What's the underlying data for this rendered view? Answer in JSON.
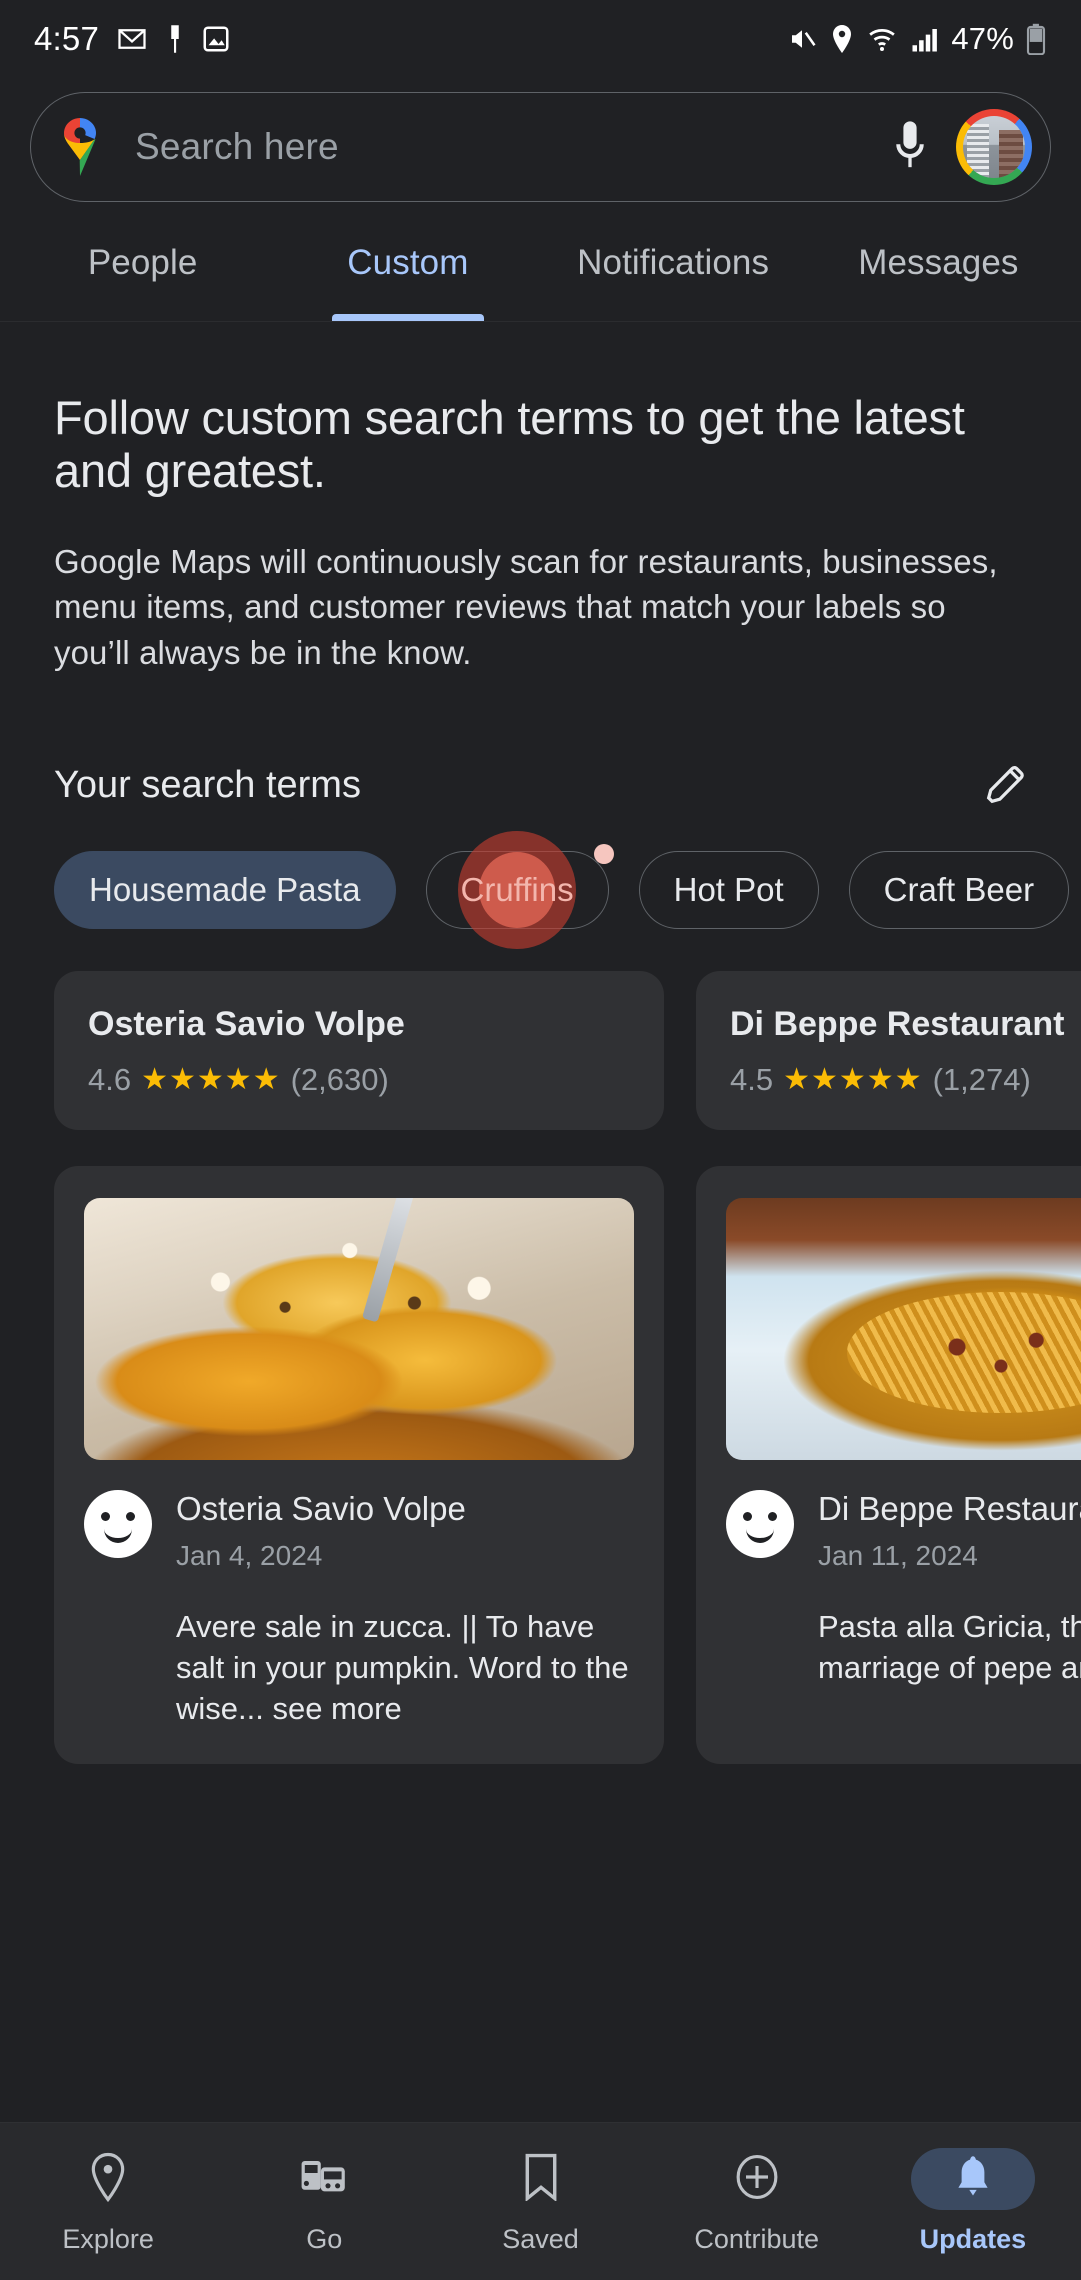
{
  "statusbar": {
    "time": "4:57",
    "battery": "47%",
    "left_icons": [
      "gmail-icon",
      "pin-icon",
      "photo-icon"
    ],
    "right_icons": [
      "mute-icon",
      "location-icon",
      "wifi-icon",
      "cell-signal-icon",
      "battery-icon"
    ]
  },
  "search": {
    "placeholder": "Search here",
    "logo": "google-maps-pin-logo",
    "mic": "microphone-icon",
    "avatar": "account-avatar"
  },
  "tabs": [
    {
      "label": "People",
      "active": false
    },
    {
      "label": "Custom",
      "active": true
    },
    {
      "label": "Notifications",
      "active": false
    },
    {
      "label": "Messages",
      "active": false
    }
  ],
  "main": {
    "headline": "Follow custom search terms to get the latest and greatest.",
    "subtext": "Google Maps will continuously scan for restaurants, businesses, menu items, and customer reviews that match your labels so you’ll always be in the know.",
    "terms_title": "Your search terms",
    "edit_icon": "pencil-icon",
    "chips": [
      {
        "label": "Housemade Pasta",
        "state": "selected"
      },
      {
        "label": "Cruffins",
        "state": "pressed",
        "badge": true
      },
      {
        "label": "Hot Pot",
        "state": "default"
      },
      {
        "label": "Craft Beer",
        "state": "default"
      }
    ],
    "places": [
      {
        "name": "Osteria Savio Volpe",
        "rating": "4.6",
        "stars": "★★★★★",
        "reviews": "(2,630)"
      },
      {
        "name": "Di Beppe Restaurant",
        "rating": "4.5",
        "stars": "★★★★★",
        "reviews": "(1,274)"
      }
    ],
    "reviews": [
      {
        "photo": "pasta-spoon-photo",
        "avatar": "smiley-avatar",
        "title": "Osteria Savio Volpe",
        "date": "Jan 4, 2024",
        "body": "Avere sale in zucca. || To have salt in your pumpkin. Word to the wise... see more"
      },
      {
        "photo": "spaghetti-bowl-photo",
        "avatar": "smiley-avatar",
        "title": "Di Beppe Restaurant",
        "date": "Jan 11, 2024",
        "body": "Pasta alla Gricia, the perfect marriage of pepe and Cacio..."
      }
    ]
  },
  "bottomnav": [
    {
      "label": "Explore",
      "icon": "map-pin-icon",
      "active": false
    },
    {
      "label": "Go",
      "icon": "commute-icon",
      "active": false
    },
    {
      "label": "Saved",
      "icon": "bookmark-icon",
      "active": false
    },
    {
      "label": "Contribute",
      "icon": "plus-circle-icon",
      "active": false
    },
    {
      "label": "Updates",
      "icon": "bell-icon",
      "active": true
    }
  ],
  "colors": {
    "background": "#202124",
    "surface": "#303134",
    "accent": "#a8c7fa",
    "chip_selected": "#3b4a61",
    "star": "#fbbc05",
    "ripple": "#c53e30"
  }
}
